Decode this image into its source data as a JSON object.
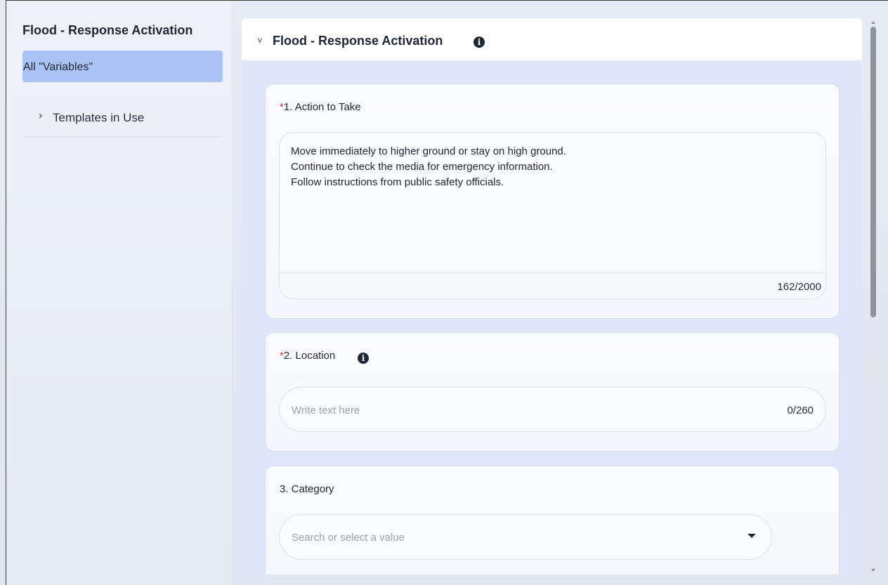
{
  "sidebar": {
    "title": "Flood - Response Activation",
    "active_item": "All \"Variables\"",
    "items": [
      {
        "label": "Templates in Use",
        "icon": "chevron-right-icon"
      }
    ]
  },
  "main": {
    "header_title": "Flood - Response Activation",
    "fields": [
      {
        "required_mark": "*",
        "label": "1. Action to Take",
        "value": "Move immediately to higher ground or stay on high ground.\nContinue to check the media for emergency information.\nFollow instructions from public safety officials.",
        "count": "162/2000"
      },
      {
        "required_mark": "*",
        "label": "2. Location",
        "placeholder": "Write text here",
        "count": "0/260"
      },
      {
        "label": "3. Category",
        "placeholder": "Search or select a value"
      }
    ]
  },
  "icons": {
    "info": "i",
    "chevron_right": "›",
    "chevron_down": "˅"
  },
  "colors": {
    "required": "#d23a3a",
    "active_sidebar": "#a9c3f5",
    "panel_bg": "#dde7f7"
  }
}
